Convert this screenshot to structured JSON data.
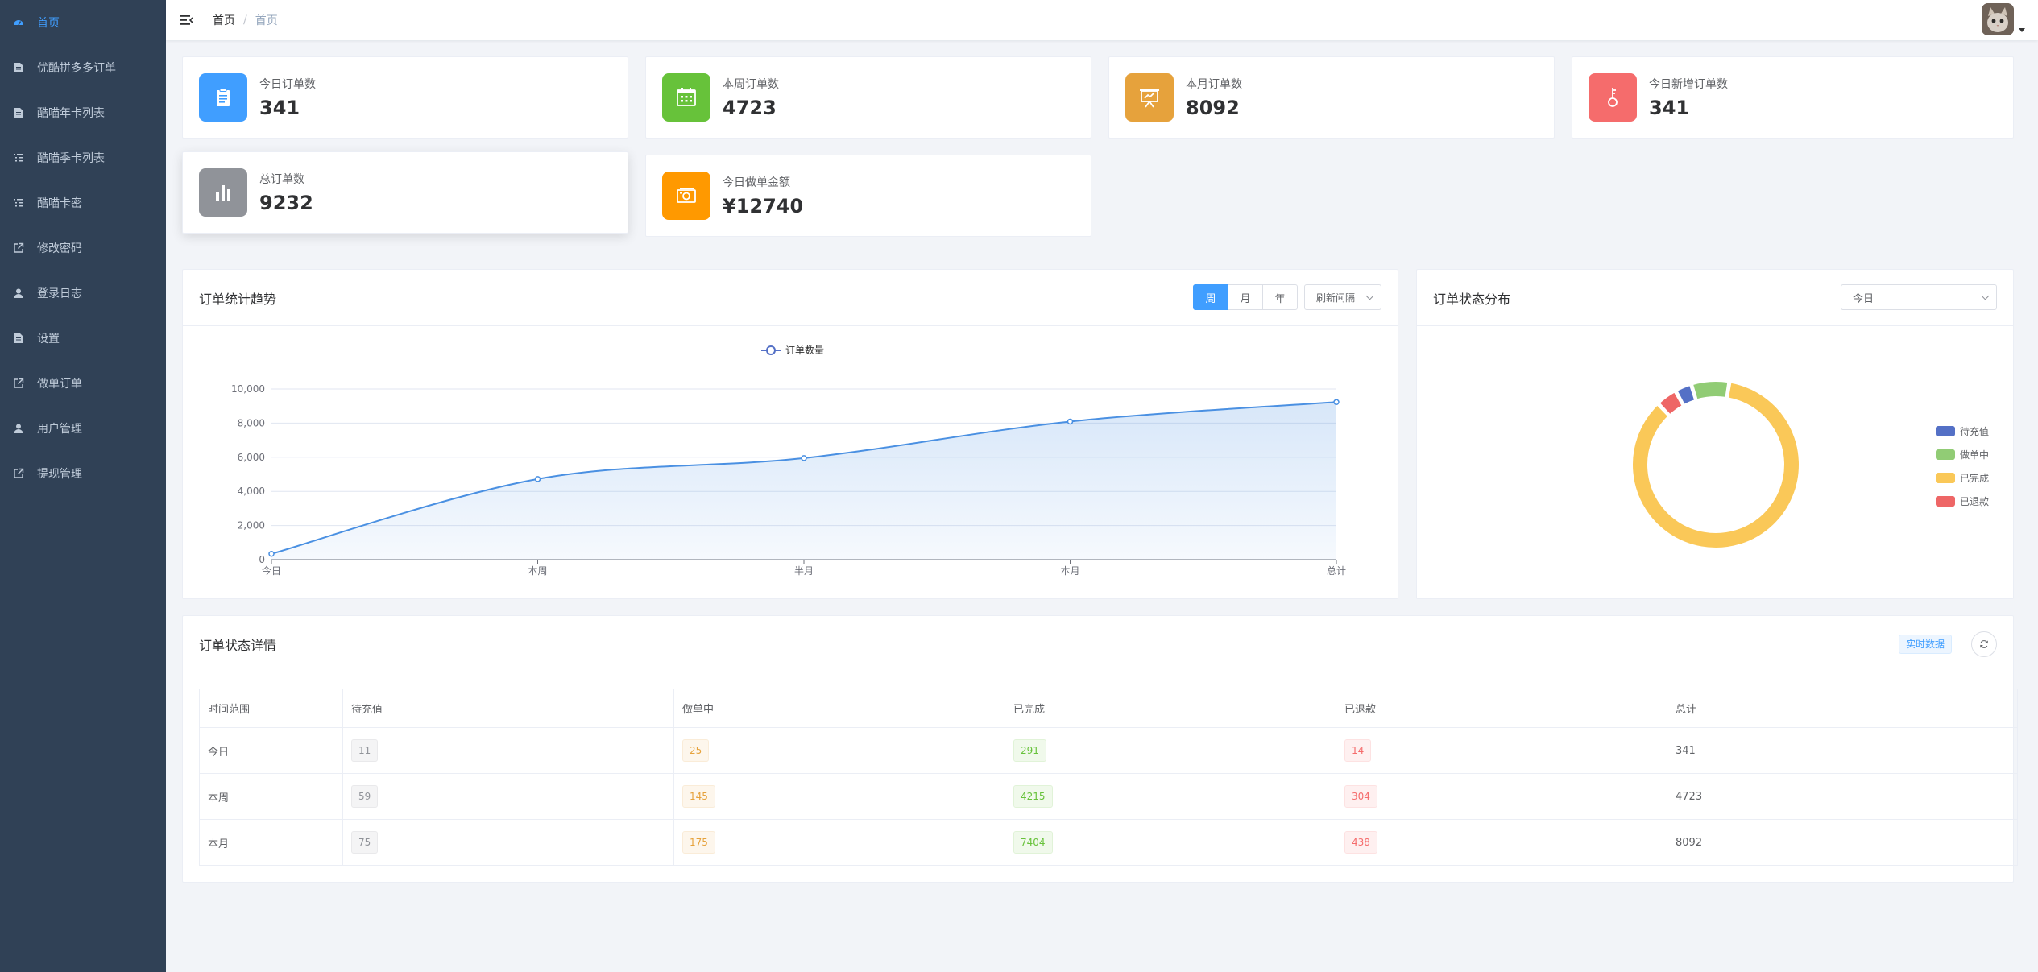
{
  "sidebar": {
    "items": [
      {
        "label": "首页",
        "icon": "dashboard-icon"
      },
      {
        "label": "优酷拼多多订单",
        "icon": "document-icon"
      },
      {
        "label": "酷喵年卡列表",
        "icon": "document-icon"
      },
      {
        "label": "酷喵季卡列表",
        "icon": "list-icon"
      },
      {
        "label": "酷喵卡密",
        "icon": "list-icon"
      },
      {
        "label": "修改密码",
        "icon": "external-link-icon"
      },
      {
        "label": "登录日志",
        "icon": "user-icon"
      },
      {
        "label": "设置",
        "icon": "document-icon"
      },
      {
        "label": "做单订单",
        "icon": "external-link-icon"
      },
      {
        "label": "用户管理",
        "icon": "user-icon"
      },
      {
        "label": "提现管理",
        "icon": "external-link-icon"
      }
    ]
  },
  "header": {
    "breadcrumb": [
      "首页",
      "首页"
    ]
  },
  "stats": [
    {
      "label": "今日订单数",
      "value": "341",
      "color": "#409eff",
      "icon": "clipboard-icon"
    },
    {
      "label": "本周订单数",
      "value": "4723",
      "color": "#67c23a",
      "icon": "calendar-icon"
    },
    {
      "label": "本月订单数",
      "value": "8092",
      "color": "#e6a23c",
      "icon": "presentation-icon"
    },
    {
      "label": "今日新增订单数",
      "value": "341",
      "color": "#f56c6c",
      "icon": "key-icon"
    },
    {
      "label": "总订单数",
      "value": "9232",
      "color": "#909399",
      "icon": "bar-chart-icon"
    },
    {
      "label": "今日做单金额",
      "value": "¥12740",
      "color": "#ff9900",
      "icon": "money-icon"
    }
  ],
  "trend": {
    "title": "订单统计趋势",
    "periods": [
      "周",
      "月",
      "年"
    ],
    "active_period": "周",
    "refresh_label": "刷新间隔"
  },
  "distribution": {
    "title": "订单状态分布",
    "select_value": "今日"
  },
  "details": {
    "title": "订单状态详情",
    "realtime_label": "实时数据",
    "columns": [
      "时间范围",
      "待充值",
      "做单中",
      "已完成",
      "已退款",
      "总计"
    ],
    "rows": [
      {
        "range": "今日",
        "pending": "11",
        "doing": "25",
        "done": "291",
        "refunded": "14",
        "total": "341"
      },
      {
        "range": "本周",
        "pending": "59",
        "doing": "145",
        "done": "4215",
        "refunded": "304",
        "total": "4723"
      },
      {
        "range": "本月",
        "pending": "75",
        "doing": "175",
        "done": "7404",
        "refunded": "438",
        "total": "8092"
      }
    ]
  },
  "chart_data": [
    {
      "type": "area",
      "legend": [
        "订单数量"
      ],
      "categories": [
        "今日",
        "本周",
        "半月",
        "本月",
        "总计"
      ],
      "series": [
        {
          "name": "订单数量",
          "values": [
            341,
            4723,
            5950,
            8092,
            9232
          ]
        }
      ],
      "ylim": [
        0,
        10000
      ],
      "yticks": [
        "0",
        "2,000",
        "4,000",
        "6,000",
        "8,000",
        "10,000"
      ],
      "color": "#4a90e2"
    },
    {
      "type": "pie",
      "labels": [
        "待充值",
        "做单中",
        "已完成",
        "已退款"
      ],
      "values": [
        11,
        25,
        291,
        14
      ],
      "colors": [
        "#5470c6",
        "#91cc75",
        "#fac858",
        "#ee6666"
      ],
      "legend": "right"
    }
  ]
}
